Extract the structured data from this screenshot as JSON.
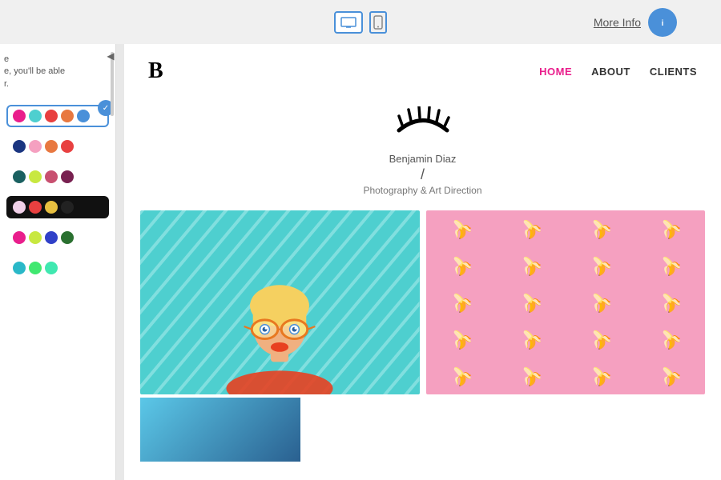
{
  "topbar": {
    "more_info_label": "More Info",
    "device_desktop_label": "Desktop view",
    "device_mobile_label": "Mobile view"
  },
  "sidebar": {
    "collapse_icon": "◀",
    "text_line1": "e",
    "text_line2": "e, you'll be able",
    "text_line3": "r.",
    "palettes": [
      {
        "id": "palette-1",
        "selected": true,
        "colors": [
          "#e91e8c",
          "#4ecfcf",
          "#e84040",
          "#e87840",
          "#4a90d9"
        ]
      },
      {
        "id": "palette-2",
        "selected": false,
        "colors": [
          "#1a3580",
          "#f5a0c0",
          "#e87840",
          "#e84040"
        ]
      },
      {
        "id": "palette-3",
        "selected": false,
        "colors": [
          "#1a6060",
          "#c8e840",
          "#c85070",
          "#782050"
        ]
      },
      {
        "id": "palette-4",
        "selected": false,
        "colors": [
          "#111111",
          "#f0d0e8",
          "#e84040",
          "#e8c040",
          "#222222"
        ]
      },
      {
        "id": "palette-5",
        "selected": false,
        "colors": [
          "#e91e8c",
          "#c8e840",
          "#3040c8",
          "#2a7030"
        ]
      },
      {
        "id": "palette-6",
        "selected": false,
        "colors": [
          "#2ab8c8",
          "#40e870",
          "#40e8b0"
        ]
      }
    ]
  },
  "website": {
    "logo": "B",
    "nav": {
      "home_label": "HOME",
      "about_label": "ABOUT",
      "clients_label": "CLIENTS"
    },
    "hero": {
      "name": "Benjamin Diaz",
      "divider": "/",
      "subtitle": "Photography & Art Direction"
    }
  }
}
